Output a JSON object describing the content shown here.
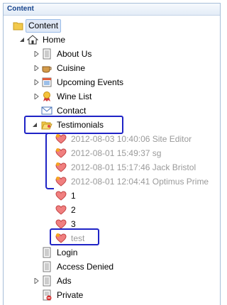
{
  "header": {
    "title": "Content"
  },
  "tree": {
    "content": "Content",
    "home": "Home",
    "about": "About Us",
    "cuisine": "Cuisine",
    "events": "Upcoming Events",
    "wine": "Wine List",
    "contact": "Contact",
    "testimonials": "Testimonials",
    "t1": "2012-08-03 10:40:06 Site Editor",
    "t2": "2012-08-01 15:49:37 sg",
    "t3": "2012-08-01 15:17:46 Jack Bristol",
    "t4": "2012-08-01 12:04:41 Optimus Prime",
    "n1": "1",
    "n2": "2",
    "n3": "3",
    "test": "test",
    "login": "Login",
    "denied": "Access Denied",
    "ads": "Ads",
    "private": "Private"
  },
  "colors": {
    "header_text": "#15428b",
    "annotation": "#1f23c6",
    "gray_text": "#9a9a9a"
  }
}
